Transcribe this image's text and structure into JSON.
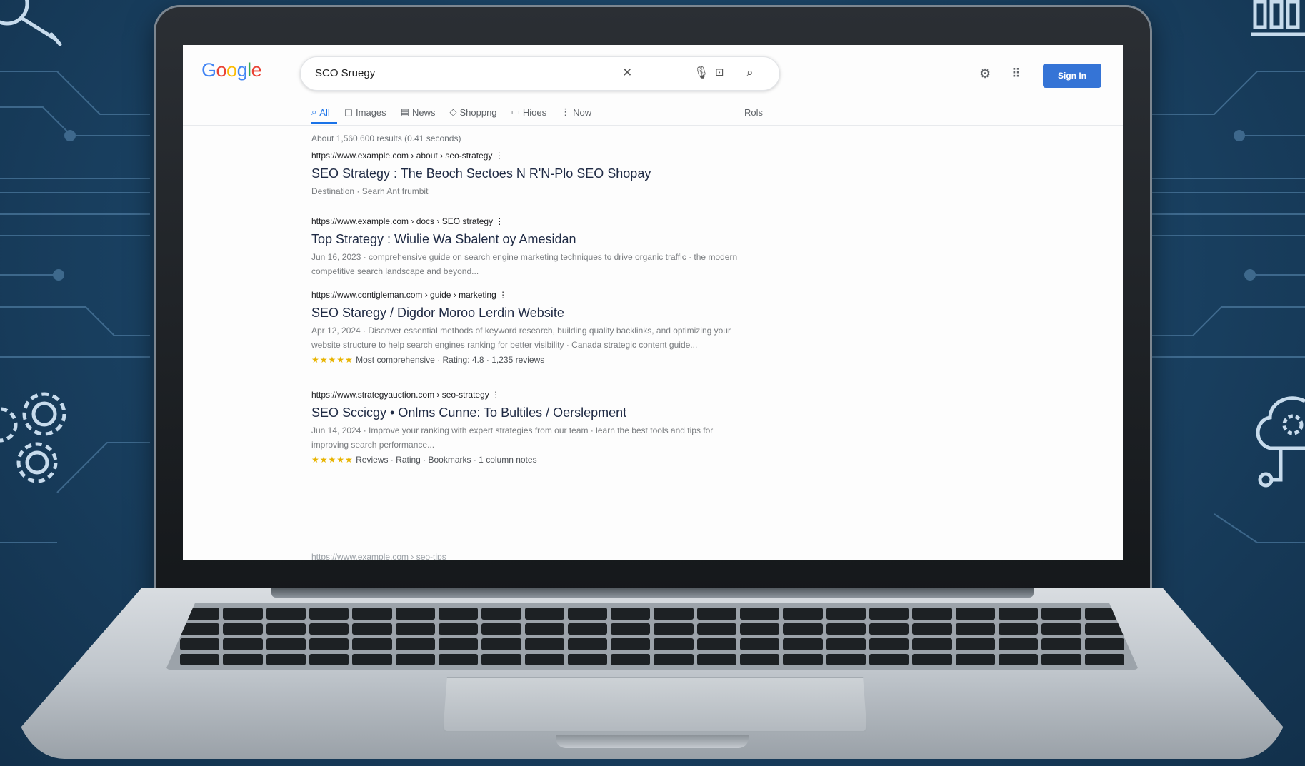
{
  "google": {
    "logo_letters": [
      "G",
      "o",
      "o",
      "g",
      "l",
      "e"
    ],
    "search_query": "SCO Sruegy",
    "signin_label": "Sign In",
    "tabs": [
      {
        "icon": "⌕",
        "label": "All",
        "active": true
      },
      {
        "icon": "▢",
        "label": "Images",
        "active": false
      },
      {
        "icon": "▤",
        "label": "News",
        "active": false
      },
      {
        "icon": "◇",
        "label": "Shoppng",
        "active": false
      },
      {
        "icon": "▭",
        "label": "Hioes",
        "active": false
      },
      {
        "icon": "⋮",
        "label": "Now",
        "active": false
      }
    ],
    "tools_label": "Rols",
    "stats": "About 1,560,600 results (0.41 seconds)",
    "results": [
      {
        "url": "https://www.example.com › about › seo-strategy ⋮",
        "title": "SEO Strategy : The Beoch Sectoes N R'N-Plo SEO Shopay",
        "snippet": "Destination · Searh Ant frumbit",
        "rating": ""
      },
      {
        "url": "https://www.example.com › docs › SEO strategy ⋮",
        "title": "Top Strategy : Wiulie Wa Sbalent oy Amesidan",
        "snippet": "Jun 16, 2023 · comprehensive guide on search engine marketing techniques to drive organic traffic · the modern competitive search landscape and beyond...",
        "rating": ""
      },
      {
        "url": "https://www.contigleman.com › guide › marketing ⋮",
        "title": "SEO Staregy / Digdor Moroo Lerdin Website",
        "snippet": "Apr 12, 2024 · Discover essential methods of keyword research, building quality backlinks, and optimizing your website structure to help search engines ranking for better visibility · Canada strategic content guide...",
        "rating": "Most comprehensive · Rating: 4.8 · 1,235 reviews"
      },
      {
        "url": "https://www.strategyauction.com › seo-strategy ⋮",
        "title": "SEO Sccicgy • Onlms Cunne: To Bultiles / Oerslepment",
        "snippet": "Jun 14, 2024 · Improve your ranking with expert strategies from our team · learn the best tools and tips for improving search performance...",
        "rating": "Reviews · Rating · Bookmarks · 1 column notes"
      }
    ],
    "partial_url": "https://www.example.com › seo-tips"
  },
  "colors": {
    "accent": "#1a73e8",
    "signin": "#3574d6",
    "background": "#1b4466"
  }
}
